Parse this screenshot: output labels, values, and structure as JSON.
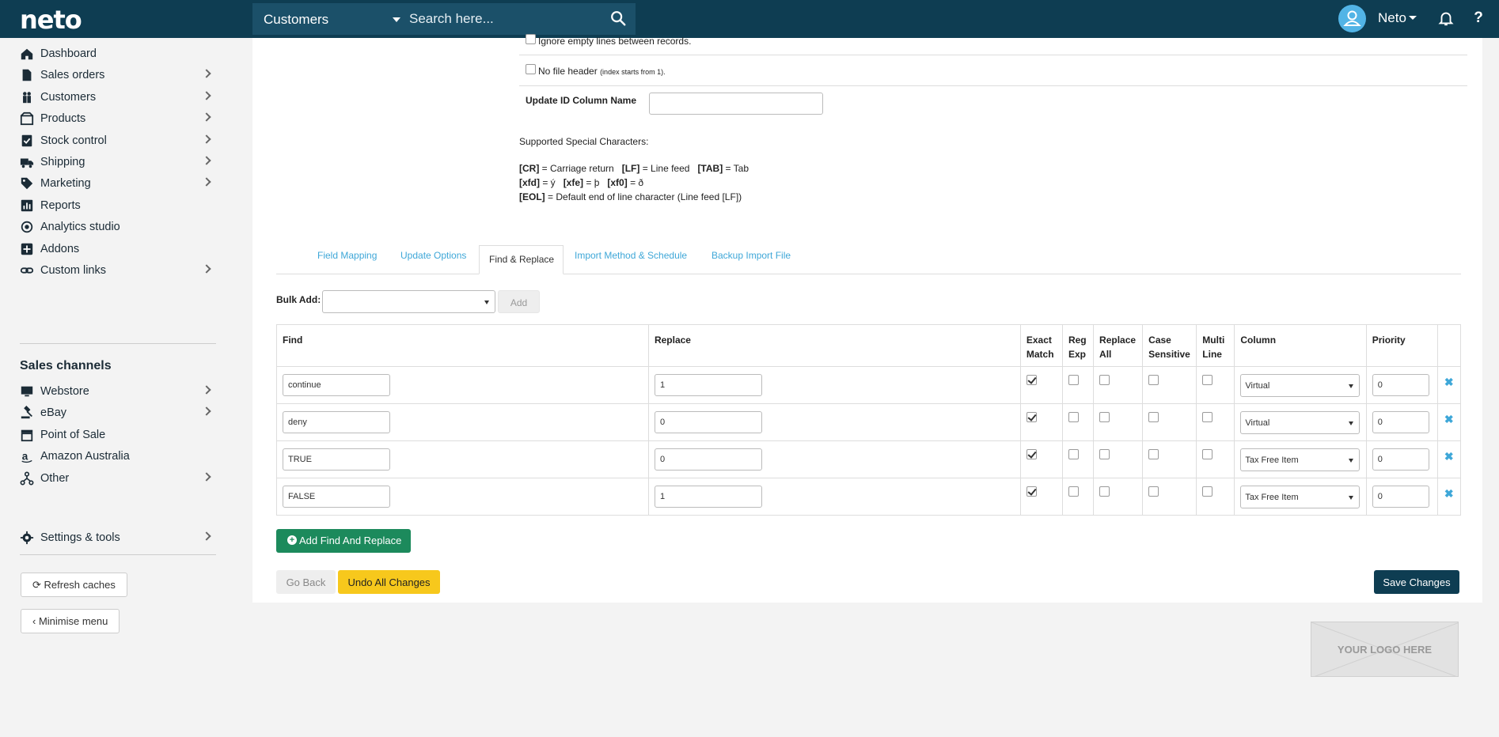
{
  "header": {
    "brand": "neto",
    "search": {
      "category": "Customers",
      "placeholder": "Search here..."
    },
    "user": "Neto",
    "help": "?"
  },
  "sidebar": {
    "items": [
      {
        "label": "Dashboard",
        "icon": "home-icon"
      },
      {
        "label": "Sales orders",
        "icon": "document-icon"
      },
      {
        "label": "Customers",
        "icon": "people-icon"
      },
      {
        "label": "Products",
        "icon": "box-icon"
      },
      {
        "label": "Stock control",
        "icon": "checklist-icon"
      },
      {
        "label": "Shipping",
        "icon": "truck-icon"
      },
      {
        "label": "Marketing",
        "icon": "tag-icon"
      },
      {
        "label": "Reports",
        "icon": "chart-icon"
      },
      {
        "label": "Analytics studio",
        "icon": "analytics-icon"
      },
      {
        "label": "Addons",
        "icon": "plus-square-icon"
      },
      {
        "label": "Custom links",
        "icon": "link-icon"
      }
    ],
    "channels_title": "Sales channels",
    "channels": [
      {
        "label": "Webstore",
        "icon": "monitor-icon"
      },
      {
        "label": "eBay",
        "icon": "gavel-icon"
      },
      {
        "label": "Point of Sale",
        "icon": "store-icon"
      },
      {
        "label": "Amazon Australia",
        "icon": "amazon-icon"
      },
      {
        "label": "Other",
        "icon": "network-icon"
      }
    ],
    "settings": {
      "label": "Settings & tools",
      "icon": "gear-icon"
    },
    "refresh_caches": "Refresh caches",
    "minimise_menu": "Minimise menu"
  },
  "options": {
    "ignore_empty": "Ignore empty lines between records.",
    "no_file_header": "No file header",
    "no_file_header_note": "(index starts from 1).",
    "update_id_label": "Update ID Column Name",
    "update_id_value": ""
  },
  "special_chars": {
    "title": "Supported Special Characters:",
    "line1": [
      {
        "code": "[CR]",
        "desc": " = Carriage return   "
      },
      {
        "code": "[LF]",
        "desc": " = Line feed   "
      },
      {
        "code": "[TAB]",
        "desc": " = Tab"
      }
    ],
    "line2": [
      {
        "code": "[xfd]",
        "desc": " = ý   "
      },
      {
        "code": "[xfe]",
        "desc": " = þ   "
      },
      {
        "code": "[xf0]",
        "desc": " = ð"
      }
    ],
    "line3": [
      {
        "code": "[EOL]",
        "desc": " = Default end of line character (Line feed [LF])"
      }
    ]
  },
  "tabs": {
    "field_mapping": "Field Mapping",
    "update_options": "Update Options",
    "find_replace": "Find & Replace",
    "import_method": "Import Method & Schedule",
    "backup": "Backup Import File"
  },
  "bulk_add": {
    "label": "Bulk Add:",
    "value": "",
    "button": "Add"
  },
  "table": {
    "headers": {
      "find": "Find",
      "replace": "Replace",
      "exact": [
        "Exact",
        "Match"
      ],
      "regexp": [
        "Reg",
        "Exp"
      ],
      "replace_all": [
        "Replace",
        "All"
      ],
      "case": [
        "Case",
        "Sensitive"
      ],
      "multi": [
        "Multi",
        "Line"
      ],
      "column": "Column",
      "priority": "Priority"
    },
    "rows": [
      {
        "find": "continue",
        "replace": "1",
        "exact": true,
        "regexp": false,
        "replace_all": false,
        "case": false,
        "multi": false,
        "column": "Virtual",
        "priority": "0"
      },
      {
        "find": "deny",
        "replace": "0",
        "exact": true,
        "regexp": false,
        "replace_all": false,
        "case": false,
        "multi": false,
        "column": "Virtual",
        "priority": "0"
      },
      {
        "find": "TRUE",
        "replace": "0",
        "exact": true,
        "regexp": false,
        "replace_all": false,
        "case": false,
        "multi": false,
        "column": "Tax Free Item",
        "priority": "0"
      },
      {
        "find": "FALSE",
        "replace": "1",
        "exact": true,
        "regexp": false,
        "replace_all": false,
        "case": false,
        "multi": false,
        "column": "Tax Free Item",
        "priority": "0"
      }
    ],
    "delete_glyph": "✖"
  },
  "actions": {
    "add_find_replace": "Add Find And Replace",
    "go_back": "Go Back",
    "undo": "Undo All Changes",
    "save": "Save Changes"
  },
  "logo_placeholder": "YOUR LOGO HERE",
  "colors": {
    "header": "#0e3d52",
    "accent": "#3ea7d8",
    "green": "#1c8a5c",
    "yellow": "#f7c81c"
  }
}
